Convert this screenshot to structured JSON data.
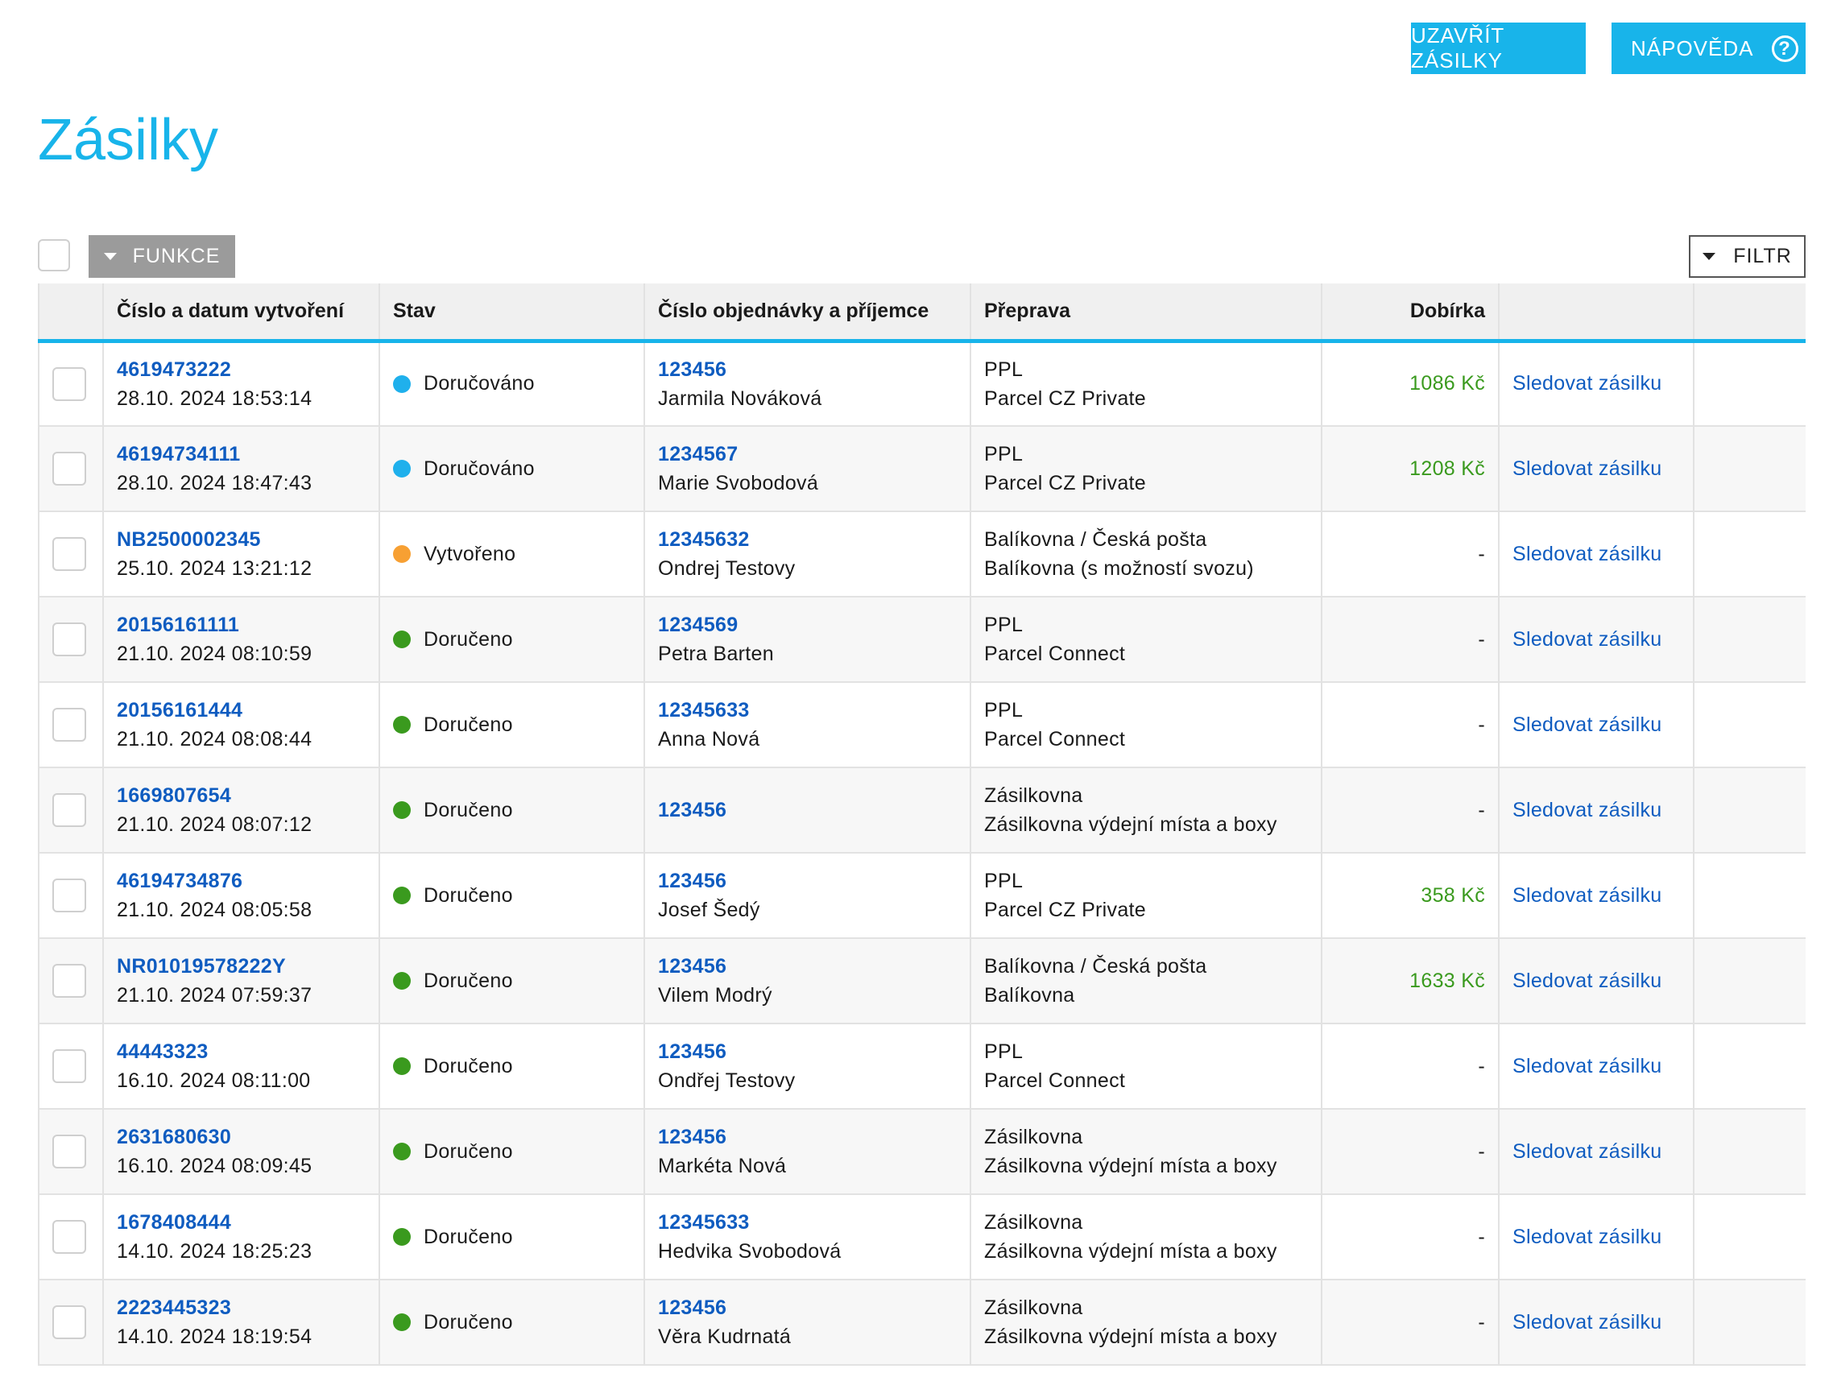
{
  "header": {
    "close_label": "UZAVŘÍT ZÁSILKY",
    "help_label": "NÁPOVĚDA",
    "help_icon": "?"
  },
  "page": {
    "title": "Zásilky"
  },
  "toolbar": {
    "functions_label": "FUNKCE",
    "filter_label": "FILTR"
  },
  "table": {
    "headers": {
      "number_date": "Číslo a datum vytvoření",
      "status": "Stav",
      "order_recipient": "Číslo objednávky a příjemce",
      "carrier": "Přeprava",
      "cod": "Dobírka"
    },
    "status_colors": {
      "delivering": "#1fb0ec",
      "created": "#f7a033",
      "delivered": "#3a9a1e"
    },
    "rows": [
      {
        "number": "4619473222",
        "date": "28.10. 2024 18:53:14",
        "status": "Doručováno",
        "status_color": "#1fb0ec",
        "order": "123456",
        "recipient": "Jarmila Nováková",
        "carrier": "PPL",
        "service": "Parcel CZ Private",
        "cod": "1086 Kč",
        "track": "Sledovat zásilku"
      },
      {
        "number": "46194734111",
        "date": "28.10. 2024 18:47:43",
        "status": "Doručováno",
        "status_color": "#1fb0ec",
        "order": "1234567",
        "recipient": "Marie Svobodová",
        "carrier": "PPL",
        "service": "Parcel CZ Private",
        "cod": "1208 Kč",
        "track": "Sledovat zásilku"
      },
      {
        "number": "NB2500002345",
        "date": "25.10. 2024 13:21:12",
        "status": "Vytvořeno",
        "status_color": "#f7a033",
        "order": "12345632",
        "recipient": "Ondrej Testovy",
        "carrier": "Balíkovna / Česká pošta",
        "service": "Balíkovna (s možností svozu)",
        "cod": "-",
        "track": "Sledovat zásilku"
      },
      {
        "number": "20156161111",
        "date": "21.10. 2024 08:10:59",
        "status": "Doručeno",
        "status_color": "#3a9a1e",
        "order": "1234569",
        "recipient": "Petra Barten",
        "carrier": "PPL",
        "service": "Parcel Connect",
        "cod": "-",
        "track": "Sledovat zásilku"
      },
      {
        "number": "20156161444",
        "date": "21.10. 2024 08:08:44",
        "status": "Doručeno",
        "status_color": "#3a9a1e",
        "order": "12345633",
        "recipient": "Anna Nová",
        "carrier": "PPL",
        "service": "Parcel Connect",
        "cod": "-",
        "track": "Sledovat zásilku"
      },
      {
        "number": "1669807654",
        "date": "21.10. 2024 08:07:12",
        "status": "Doručeno",
        "status_color": "#3a9a1e",
        "order": "123456",
        "recipient": "",
        "carrier": "Zásilkovna",
        "service": "Zásilkovna výdejní místa a boxy",
        "cod": "-",
        "track": "Sledovat zásilku"
      },
      {
        "number": "46194734876",
        "date": "21.10. 2024 08:05:58",
        "status": "Doručeno",
        "status_color": "#3a9a1e",
        "order": "123456",
        "recipient": "Josef Šedý",
        "carrier": "PPL",
        "service": "Parcel CZ Private",
        "cod": "358 Kč",
        "track": "Sledovat zásilku"
      },
      {
        "number": "NR01019578222Y",
        "date": "21.10. 2024 07:59:37",
        "status": "Doručeno",
        "status_color": "#3a9a1e",
        "order": "123456",
        "recipient": "Vilem Modrý",
        "carrier": "Balíkovna / Česká pošta",
        "service": "Balíkovna",
        "cod": "1633 Kč",
        "track": "Sledovat zásilku"
      },
      {
        "number": "44443323",
        "date": "16.10. 2024 08:11:00",
        "status": "Doručeno",
        "status_color": "#3a9a1e",
        "order": "123456",
        "recipient": "Ondřej Testovy",
        "carrier": "PPL",
        "service": "Parcel Connect",
        "cod": "-",
        "track": "Sledovat zásilku"
      },
      {
        "number": "2631680630",
        "date": "16.10. 2024 08:09:45",
        "status": "Doručeno",
        "status_color": "#3a9a1e",
        "order": "123456",
        "recipient": "Markéta Nová",
        "carrier": "Zásilkovna",
        "service": "Zásilkovna výdejní místa a boxy",
        "cod": "-",
        "track": "Sledovat zásilku"
      },
      {
        "number": "1678408444",
        "date": "14.10. 2024 18:25:23",
        "status": "Doručeno",
        "status_color": "#3a9a1e",
        "order": "12345633",
        "recipient": "Hedvika Svobodová",
        "carrier": "Zásilkovna",
        "service": "Zásilkovna výdejní místa a boxy",
        "cod": "-",
        "track": "Sledovat zásilku"
      },
      {
        "number": "2223445323",
        "date": "14.10. 2024 18:19:54",
        "status": "Doručeno",
        "status_color": "#3a9a1e",
        "order": "123456",
        "recipient": "Věra Kudrnatá",
        "carrier": "Zásilkovna",
        "service": "Zásilkovna výdejní místa a boxy",
        "cod": "-",
        "track": "Sledovat zásilku"
      }
    ]
  }
}
